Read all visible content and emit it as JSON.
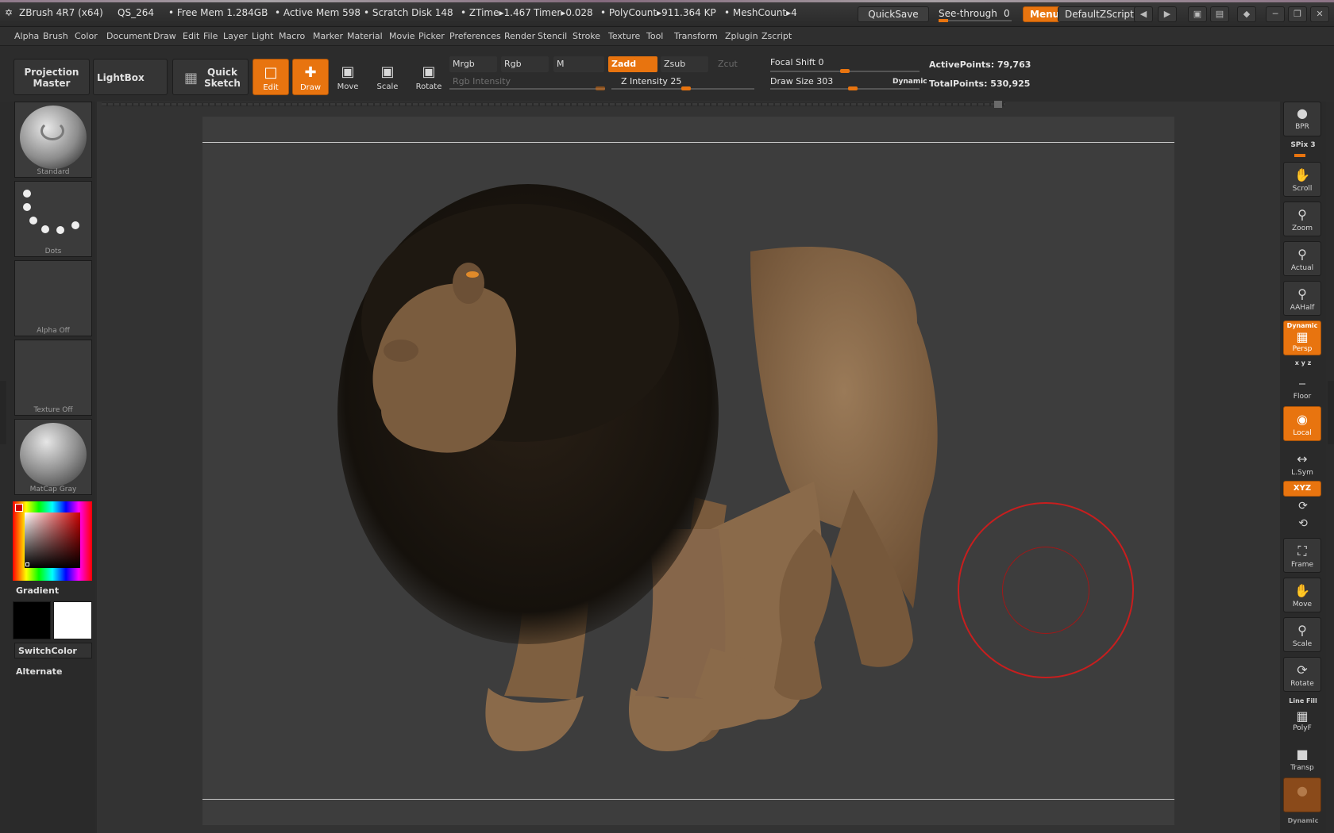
{
  "titlebar": {
    "app": "ZBrush 4R7 (x64)",
    "project": "QS_264",
    "free_mem": "• Free Mem 1.284GB",
    "active_mem": "• Active Mem 598",
    "scratch": "• Scratch Disk 148",
    "ztime": "• ZTime▸1.467",
    "timer": "Timer▸0.028",
    "polycount": "• PolyCount▸911.364 KP",
    "meshcount": "• MeshCount▸4",
    "quicksave": "QuickSave",
    "see_through": "See-through",
    "see_through_value": "0",
    "see_through_fraction": 0.0,
    "menus": "Menus",
    "default_script": "DefaultZScript"
  },
  "menu": [
    "Alpha",
    "Brush",
    "Color",
    "Document",
    "Draw",
    "Edit",
    "File",
    "Layer",
    "Light",
    "Macro",
    "Marker",
    "Material",
    "Movie",
    "Picker",
    "Preferences",
    "Render",
    "Stencil",
    "Stroke",
    "Texture",
    "Tool",
    "Transform",
    "Zplugin",
    "Zscript"
  ],
  "shelf": {
    "projection_master_1": "Projection",
    "projection_master_2": "Master",
    "lightbox": "LightBox",
    "quick_sketch_1": "Quick",
    "quick_sketch_2": "Sketch",
    "edit": "Edit",
    "draw": "Draw",
    "move": "Move",
    "scale": "Scale",
    "rotate": "Rotate",
    "mrgb": "Mrgb",
    "rgb": "Rgb",
    "m": "M",
    "zadd": "Zadd",
    "zsub": "Zsub",
    "zcut": "Zcut",
    "rgb_intensity": "Rgb Intensity",
    "z_intensity": "Z Intensity 25",
    "z_intensity_value": 25,
    "focal_shift": "Focal Shift 0",
    "focal_shift_value": 0,
    "draw_size": "Draw Size 303",
    "draw_size_value": 303,
    "dynamic": "Dynamic",
    "active_points": "ActivePoints: 79,763",
    "total_points": "TotalPoints: 530,925"
  },
  "left": {
    "brush": "Standard",
    "stroke": "Dots",
    "alpha": "Alpha Off",
    "texture": "Texture Off",
    "material": "MatCap Gray",
    "gradient": "Gradient",
    "switch_color": "SwitchColor",
    "alternate": "Alternate",
    "main_color": "#000000",
    "secondary_color": "#ffffff"
  },
  "right": {
    "bpr": "BPR",
    "spix": "SPix 3",
    "scroll": "Scroll",
    "zoom": "Zoom",
    "actual": "Actual",
    "aahalf": "AAHalf",
    "dynamic": "Dynamic",
    "persp": "Persp",
    "xyz_small": "x y z",
    "floor": "Floor",
    "local": "Local",
    "lsym": "L.Sym",
    "xyz": "XYZ",
    "frame": "Frame",
    "move": "Move",
    "scale": "Scale",
    "rotate": "Rotate",
    "line_fill": "Line Fill",
    "polyf": "PolyF",
    "transp": "Transp",
    "dynamic2": "Dynamic"
  },
  "colors": {
    "accent": "#e8740f",
    "brush_cursor": "#c81e1e",
    "lion_body": "#8a6a4a",
    "mane": "#1c1610"
  }
}
